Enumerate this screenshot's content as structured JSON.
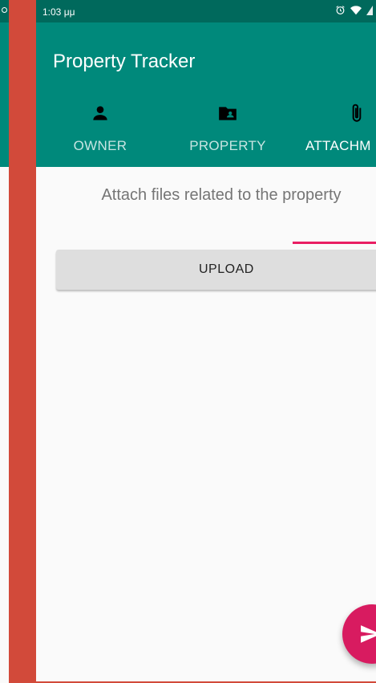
{
  "status_bar": {
    "time": "1:03 μμ",
    "icons": [
      "alarm-icon",
      "wifi-icon",
      "signal-icon"
    ]
  },
  "app_bar": {
    "title": "Property Tracker"
  },
  "tabs": [
    {
      "label": "OWNER",
      "icon": "person-icon",
      "active": false
    },
    {
      "label": "PROPERTY",
      "icon": "folder-shared-icon",
      "active": false
    },
    {
      "label": "ATTACHM",
      "icon": "paperclip-icon",
      "active": true
    }
  ],
  "content": {
    "description": "Attach files related to the property",
    "upload_label": "UPLOAD"
  },
  "fab": {
    "icon": "send-icon"
  },
  "colors": {
    "primary": "#00897b",
    "primary_dark": "#00695c",
    "accent": "#e91e63",
    "background_frame": "#d24a3a"
  }
}
